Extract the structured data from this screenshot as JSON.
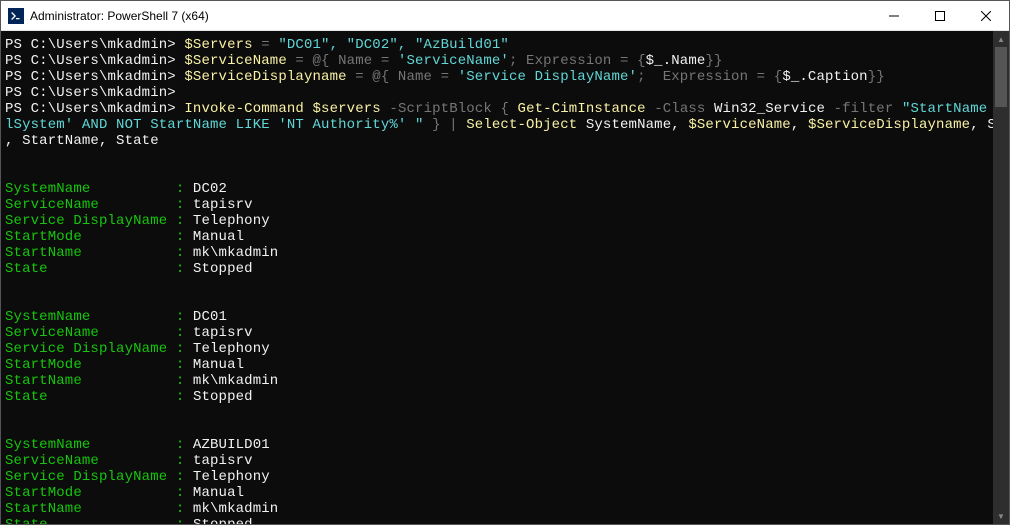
{
  "window": {
    "title": "Administrator: PowerShell 7 (x64)",
    "icon_label": "PS"
  },
  "prompt": "PS C:\\Users\\mkadmin>",
  "commands": {
    "line1": {
      "prompt": "PS C:\\Users\\mkadmin> ",
      "var": "$Servers",
      "eq": " = ",
      "val": "\"DC01\", \"DC02\", \"AzBuild01\""
    },
    "line2": {
      "prompt": "PS C:\\Users\\mkadmin> ",
      "var": "$ServiceName",
      "eq": " = @{ Name = ",
      "str": "'ServiceName'",
      "mid": "; Expression = {",
      "expr": "$_.Name",
      "end": "}}"
    },
    "line3": {
      "prompt": "PS C:\\Users\\mkadmin> ",
      "var": "$ServiceDisplayname",
      "eq": " = @{ Name = ",
      "str": "'Service DisplayName'",
      "mid": ";  Expression = {",
      "expr": "$_.Caption",
      "end": "}}"
    },
    "line4": {
      "prompt": "PS C:\\Users\\mkadmin>"
    },
    "line5a": {
      "prompt": "PS C:\\Users\\mkadmin> ",
      "cmd1": "Invoke-Command",
      "sp1": " ",
      "var1": "$servers",
      "sb": " -ScriptBlock ",
      "brace1": "{ ",
      "cmd2": "Get-CimInstance",
      "class": " -Class ",
      "classname": "Win32_Service",
      "filter": " -filter ",
      "filterstr": "\"StartName != 'Loca"
    },
    "line5b": {
      "filterstr": "lSystem' AND NOT StartName LIKE 'NT Authority%' \"",
      "brace2": " } | ",
      "cmd3": "Select-Object",
      "p1": " SystemName, ",
      "var1": "$ServiceName",
      "comma1": ", ",
      "var2": "$ServiceDisplayname",
      "p2": ", StartMode"
    },
    "line5c": {
      "tail": ", StartName, State"
    }
  },
  "output_labels": {
    "SystemName": "SystemName",
    "ServiceName": "ServiceName",
    "ServiceDisplayName": "Service DisplayName",
    "StartMode": "StartMode",
    "StartName": "StartName",
    "State": "State"
  },
  "records": [
    {
      "SystemName": "DC02",
      "ServiceName": "tapisrv",
      "ServiceDisplayName": "Telephony",
      "StartMode": "Manual",
      "StartName": "mk\\mkadmin",
      "State": "Stopped"
    },
    {
      "SystemName": "DC01",
      "ServiceName": "tapisrv",
      "ServiceDisplayName": "Telephony",
      "StartMode": "Manual",
      "StartName": "mk\\mkadmin",
      "State": "Stopped"
    },
    {
      "SystemName": "AZBUILD01",
      "ServiceName": "tapisrv",
      "ServiceDisplayName": "Telephony",
      "StartMode": "Manual",
      "StartName": "mk\\mkadmin",
      "State": "Stopped"
    }
  ]
}
